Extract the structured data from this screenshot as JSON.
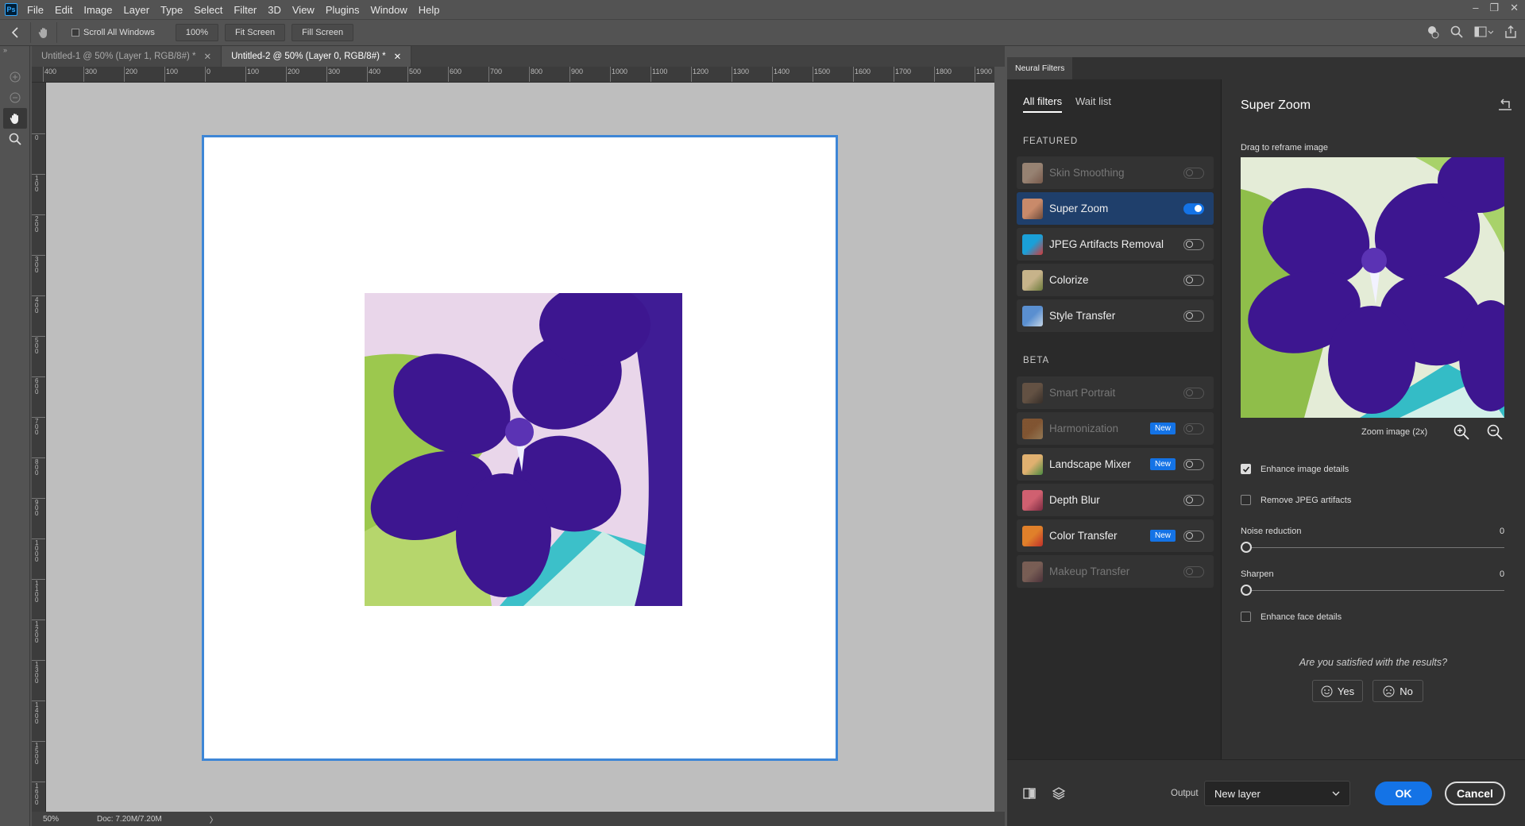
{
  "app": {
    "logo": "Ps"
  },
  "menu": [
    "File",
    "Edit",
    "Image",
    "Layer",
    "Type",
    "Select",
    "Filter",
    "3D",
    "View",
    "Plugins",
    "Window",
    "Help"
  ],
  "options": {
    "scroll_all_windows": "Scroll All Windows",
    "zoom_100": "100%",
    "fit_screen": "Fit Screen",
    "fill_screen": "Fill Screen"
  },
  "tabs": [
    {
      "label": "Untitled-1 @ 50% (Layer 1, RGB/8#) *"
    },
    {
      "label": "Untitled-2 @ 50% (Layer 0, RGB/8#) *"
    }
  ],
  "ruler_h": [
    "400",
    "300",
    "200",
    "100",
    "0",
    "100",
    "200",
    "300",
    "400",
    "500",
    "600",
    "700",
    "800",
    "900",
    "1000",
    "1100",
    "1200",
    "1300",
    "1400",
    "1500",
    "1600",
    "1700",
    "1800",
    "1900"
  ],
  "ruler_v": [
    "0",
    "1 0 0",
    "2 0 0",
    "3 0 0",
    "4 0 0",
    "5 0 0",
    "6 0 0",
    "7 0 0",
    "8 0 0",
    "9 0 0",
    "1 0 0 0",
    "1 1 0 0",
    "1 2 0 0",
    "1 3 0 0",
    "1 4 0 0",
    "1 5 0 0",
    "1 6 0 0"
  ],
  "status": {
    "zoom": "50%",
    "doc": "Doc: 7.20M/7.20M",
    "arrow": "〉"
  },
  "neural": {
    "panel_tab": "Neural Filters",
    "tab_all": "All filters",
    "tab_wait": "Wait list",
    "featured_head": "FEATURED",
    "beta_head": "BETA",
    "featured": [
      {
        "name": "Skin Smoothing",
        "state": "disabled"
      },
      {
        "name": "Super Zoom",
        "state": "on"
      },
      {
        "name": "JPEG Artifacts Removal",
        "state": "off"
      },
      {
        "name": "Colorize",
        "state": "off"
      },
      {
        "name": "Style Transfer",
        "state": "off"
      }
    ],
    "beta": [
      {
        "name": "Smart Portrait",
        "state": "disabled",
        "badge": ""
      },
      {
        "name": "Harmonization",
        "state": "disabled",
        "badge": "New"
      },
      {
        "name": "Landscape Mixer",
        "state": "off",
        "badge": "New"
      },
      {
        "name": "Depth Blur",
        "state": "off",
        "badge": ""
      },
      {
        "name": "Color Transfer",
        "state": "off",
        "badge": "New"
      },
      {
        "name": "Makeup Transfer",
        "state": "disabled",
        "badge": ""
      }
    ],
    "settings": {
      "title": "Super Zoom",
      "drag_hint": "Drag to reframe image",
      "zoom_label": "Zoom image (2x)",
      "enhance_details": "Enhance image details",
      "enhance_details_checked": true,
      "remove_jpeg": "Remove JPEG artifacts",
      "remove_jpeg_checked": false,
      "noise_label": "Noise reduction",
      "noise_value": "0",
      "sharpen_label": "Sharpen",
      "sharpen_value": "0",
      "face_label": "Enhance face details",
      "face_checked": false,
      "question": "Are you satisfied with the results?",
      "yes": "Yes",
      "no": "No"
    },
    "bottom": {
      "output_label": "Output",
      "output_value": "New layer",
      "ok": "OK",
      "cancel": "Cancel"
    }
  },
  "colors": {
    "accent": "#1473e6",
    "selection_border": "#3e86d6",
    "flower": "#3d1690",
    "leaf": "#9cc84e"
  }
}
